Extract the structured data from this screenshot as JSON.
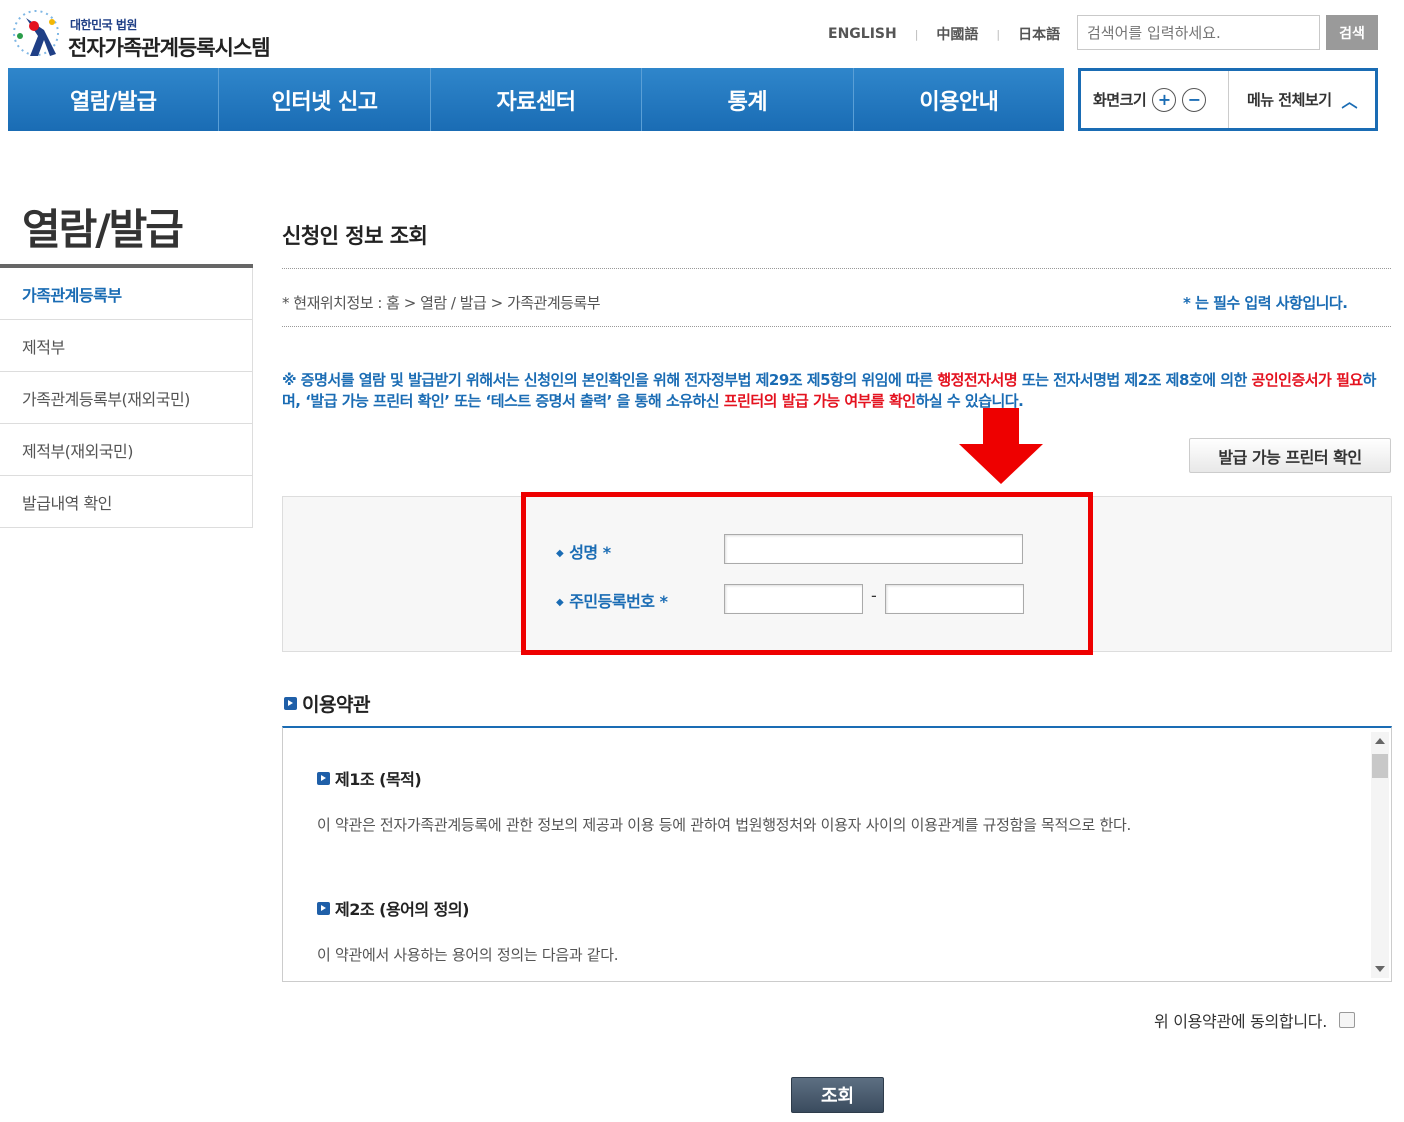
{
  "header": {
    "logo_sub": "대한민국 법원",
    "logo_main": "전자가족관계등록시스템",
    "languages": [
      "ENGLISH",
      "中國語",
      "日本語"
    ],
    "search_placeholder": "검색어를 입력하세요.",
    "search_button": "검색"
  },
  "nav": {
    "items": [
      "열람/발급",
      "인터넷 신고",
      "자료센터",
      "통계",
      "이용안내"
    ]
  },
  "util": {
    "font_size_label": "화면크기",
    "plus": "+",
    "minus": "−",
    "all_menu_label": "메뉴 전체보기"
  },
  "sidebar": {
    "title": "열람/발급",
    "items": [
      "가족관계등록부",
      "제적부",
      "가족관계등록부(재외국민)",
      "제적부(재외국민)",
      "발급내역 확인"
    ],
    "active_index": 0
  },
  "main": {
    "page_title": "신청인 정보 조회",
    "location": "* 현재위치정보 : 홈 > 열람 / 발급 > 가족관계등록부",
    "required_note": "* 는 필수 입력 사항입니다.",
    "notice": {
      "p1": "※ 증명서를 열람 및 발급받기 위해서는 신청인의 본인확인을 위해 전자정부법 제29조 제5항의 위임에 따른 ",
      "r1": "행정전자서명",
      "p2": " 또는 전자서명법 제2조 제8호에 의한 ",
      "r2": "공인인증서가 필요",
      "p3": "하며, ‘발급 가능 프린터 확인’ 또는 ‘테스트 증명서 출력’ 을 통해 소유하신 ",
      "r3": "프린터의 발급 가능 여부를 확인",
      "p4": "하실 수 있습니다."
    },
    "printer_button": "발급 가능 프린터 확인",
    "form": {
      "name_label": "성명 *",
      "rrn_label": "주민등록번호 *",
      "dash": "-",
      "name_value": "",
      "rrn_front_value": "",
      "rrn_back_value": ""
    },
    "terms": {
      "title": "이용약관",
      "articles": [
        {
          "title": "제1조 (목적)",
          "body": "이 약관은 전자가족관계등록에 관한 정보의 제공과 이용 등에 관하여 법원행정처와 이용자 사이의 이용관계를 규정함을 목적으로 한다."
        },
        {
          "title": "제2조 (용어의 정의)",
          "body": "이 약관에서 사용하는 용어의 정의는 다음과 같다."
        }
      ]
    },
    "agree_label": "위 이용약관에 동의합니다.",
    "agree_checked": false,
    "submit_button": "조회"
  },
  "colors": {
    "brand_blue": "#1a6cb4",
    "highlight_red": "#ee0000",
    "notice_red": "#e4121f"
  }
}
